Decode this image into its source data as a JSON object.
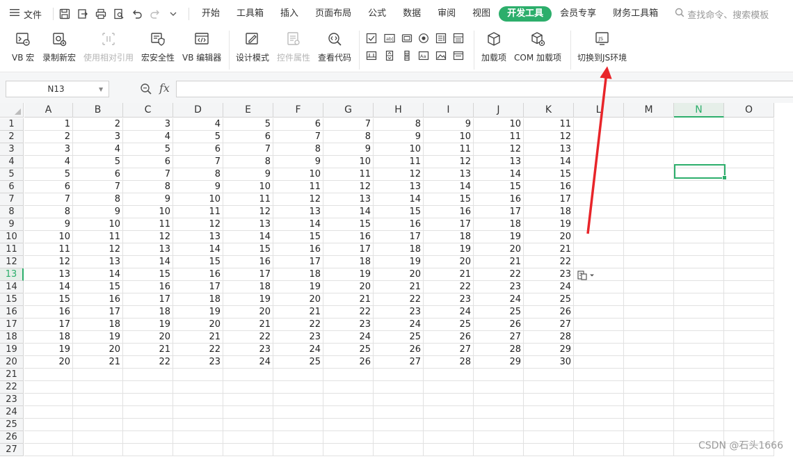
{
  "menubar": {
    "file_label": "文件",
    "tabs": [
      {
        "label": "开始",
        "active": false
      },
      {
        "label": "工具箱",
        "active": false
      },
      {
        "label": "插入",
        "active": false
      },
      {
        "label": "页面布局",
        "active": false
      },
      {
        "label": "公式",
        "active": false
      },
      {
        "label": "数据",
        "active": false
      },
      {
        "label": "审阅",
        "active": false
      },
      {
        "label": "视图",
        "active": false
      },
      {
        "label": "开发工具",
        "active": true
      },
      {
        "label": "会员专享",
        "active": false
      },
      {
        "label": "财务工具箱",
        "active": false
      }
    ],
    "search_placeholder": "查找命令、搜索模板"
  },
  "ribbon": {
    "buttons": [
      {
        "label": "VB 宏",
        "icon": "vb-macro-icon",
        "enabled": true
      },
      {
        "label": "录制新宏",
        "icon": "record-macro-icon",
        "enabled": true
      },
      {
        "label": "使用相对引用",
        "icon": "relative-reference-icon",
        "enabled": false
      },
      {
        "label": "宏安全性",
        "icon": "macro-security-icon",
        "enabled": true
      },
      {
        "label": "VB 编辑器",
        "icon": "vb-editor-icon",
        "enabled": true
      },
      {
        "label": "设计模式",
        "icon": "design-mode-icon",
        "enabled": true
      },
      {
        "label": "控件属性",
        "icon": "control-properties-icon",
        "enabled": false
      },
      {
        "label": "查看代码",
        "icon": "view-code-icon",
        "enabled": true
      },
      {
        "label": "加载项",
        "icon": "addins-icon",
        "enabled": true
      },
      {
        "label": "COM 加载项",
        "icon": "com-addins-icon",
        "enabled": true
      },
      {
        "label": "切换到JS环境",
        "icon": "switch-js-icon",
        "enabled": true
      }
    ]
  },
  "formula_bar": {
    "name_box": "N13",
    "fx_label": "fx",
    "formula": ""
  },
  "sheet": {
    "columns": [
      "A",
      "B",
      "C",
      "D",
      "E",
      "F",
      "G",
      "H",
      "I",
      "J",
      "K",
      "L",
      "M",
      "N",
      "O"
    ],
    "selected_column": "N",
    "selected_row": 13,
    "rows": [
      [
        1,
        2,
        3,
        4,
        5,
        6,
        7,
        8,
        9,
        10,
        11
      ],
      [
        2,
        3,
        4,
        5,
        6,
        7,
        8,
        9,
        10,
        11,
        12
      ],
      [
        3,
        4,
        5,
        6,
        7,
        8,
        9,
        10,
        11,
        12,
        13
      ],
      [
        4,
        5,
        6,
        7,
        8,
        9,
        10,
        11,
        12,
        13,
        14
      ],
      [
        5,
        6,
        7,
        8,
        9,
        10,
        11,
        12,
        13,
        14,
        15
      ],
      [
        6,
        7,
        8,
        9,
        10,
        11,
        12,
        13,
        14,
        15,
        16
      ],
      [
        7,
        8,
        9,
        10,
        11,
        12,
        13,
        14,
        15,
        16,
        17
      ],
      [
        8,
        9,
        10,
        11,
        12,
        13,
        14,
        15,
        16,
        17,
        18
      ],
      [
        9,
        10,
        11,
        12,
        13,
        14,
        15,
        16,
        17,
        18,
        19
      ],
      [
        10,
        11,
        12,
        13,
        14,
        15,
        16,
        17,
        18,
        19,
        20
      ],
      [
        11,
        12,
        13,
        14,
        15,
        16,
        17,
        18,
        19,
        20,
        21
      ],
      [
        12,
        13,
        14,
        15,
        16,
        17,
        18,
        19,
        20,
        21,
        22
      ],
      [
        13,
        14,
        15,
        16,
        17,
        18,
        19,
        20,
        21,
        22,
        23
      ],
      [
        14,
        15,
        16,
        17,
        18,
        19,
        20,
        21,
        22,
        23,
        24
      ],
      [
        15,
        16,
        17,
        18,
        19,
        20,
        21,
        22,
        23,
        24,
        25
      ],
      [
        16,
        17,
        18,
        19,
        20,
        21,
        22,
        23,
        24,
        25,
        26
      ],
      [
        17,
        18,
        19,
        20,
        21,
        22,
        23,
        24,
        25,
        26,
        27
      ],
      [
        18,
        19,
        20,
        21,
        22,
        23,
        24,
        25,
        26,
        27,
        28
      ],
      [
        19,
        20,
        21,
        22,
        23,
        24,
        25,
        26,
        27,
        28,
        29
      ],
      [
        20,
        21,
        22,
        23,
        24,
        25,
        26,
        27,
        28,
        29,
        30
      ]
    ],
    "row_count": 27
  },
  "colors": {
    "accent": "#2cae6b",
    "annotation_arrow": "#e8252a"
  },
  "watermark": "CSDN @石头1666"
}
